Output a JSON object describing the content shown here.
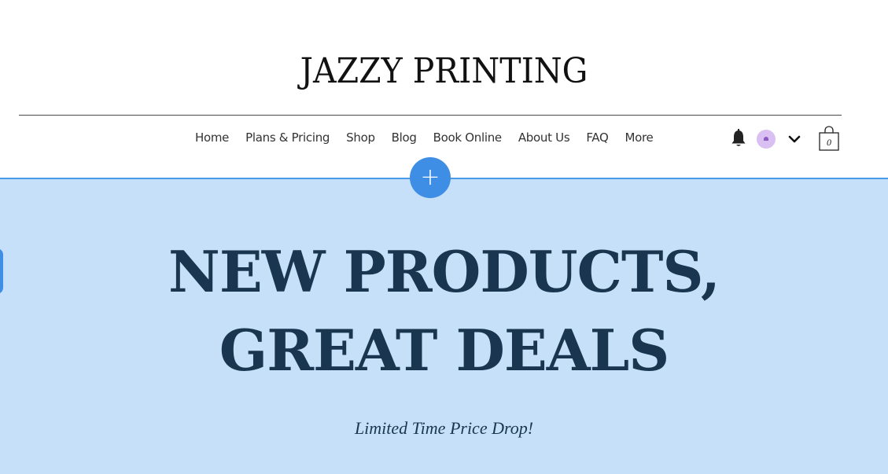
{
  "header": {
    "site_title": "JAZZY PRINTING"
  },
  "nav": {
    "items": [
      {
        "label": "Home"
      },
      {
        "label": "Plans & Pricing"
      },
      {
        "label": "Shop"
      },
      {
        "label": "Blog"
      },
      {
        "label": "Book Online"
      },
      {
        "label": "About Us"
      },
      {
        "label": "FAQ"
      },
      {
        "label": "More"
      }
    ]
  },
  "icons": {
    "notifications": "bell-icon",
    "account": "avatar",
    "account_menu": "chevron-down-icon",
    "cart": "shopping-bag-icon"
  },
  "cart": {
    "count": "0"
  },
  "editor": {
    "add_button_glyph": "+"
  },
  "hero": {
    "heading_line1": "NEW PRODUCTS,",
    "heading_line2": "GREAT DEALS",
    "subheading": "Limited Time Price Drop!"
  },
  "colors": {
    "hero_background": "#c5e0f8",
    "hero_text": "#1a3550",
    "accent_blue": "#3e8ee6",
    "avatar_background": "#d9bff2"
  }
}
